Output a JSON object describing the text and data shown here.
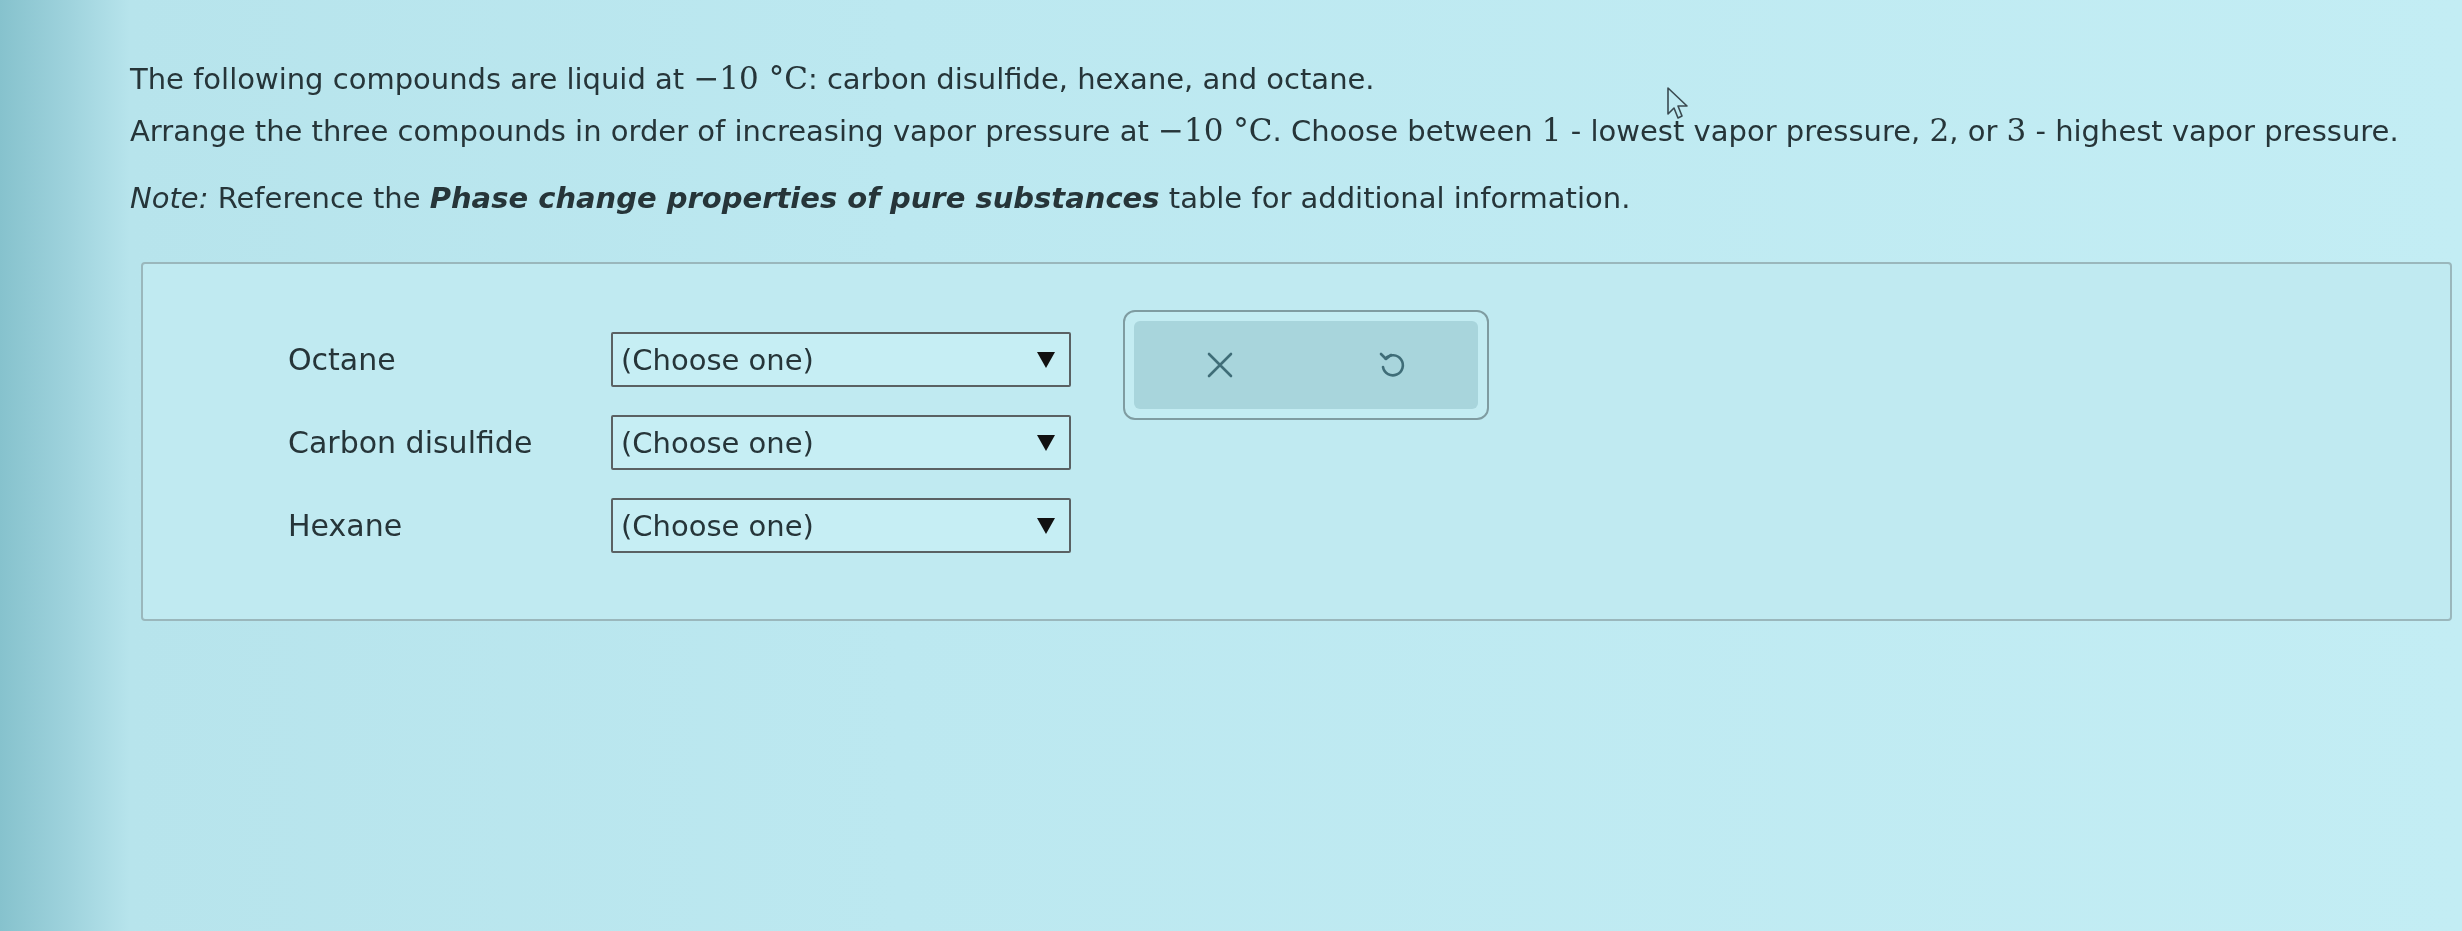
{
  "question": {
    "lines": [
      {
        "segments": [
          {
            "kind": "text",
            "text": "The following compounds are liquid at "
          },
          {
            "kind": "math",
            "text": "−10 °C"
          },
          {
            "kind": "text",
            "text": ": carbon disulfide, hexane, and octane."
          }
        ]
      },
      {
        "segments": [
          {
            "kind": "text",
            "text": "Arrange the three compounds in order of increasing vapor pressure at "
          },
          {
            "kind": "math",
            "text": "−10 °C"
          },
          {
            "kind": "text",
            "text": ". Choose between "
          },
          {
            "kind": "math",
            "text": "1"
          },
          {
            "kind": "text",
            "text": " - lowest vapor pressure, "
          },
          {
            "kind": "math",
            "text": "2"
          },
          {
            "kind": "text",
            "text": ", or "
          },
          {
            "kind": "math",
            "text": "3"
          },
          {
            "kind": "text",
            "text": " - highest vapor pressure."
          }
        ]
      }
    ],
    "note": {
      "segments": [
        {
          "kind": "italic",
          "text": "Note:"
        },
        {
          "kind": "text",
          "text": " Reference the "
        },
        {
          "kind": "bold-italic",
          "text": "Phase change properties of pure substances"
        },
        {
          "kind": "text",
          "text": " table for additional information."
        }
      ]
    }
  },
  "answer_panel": {
    "rows": [
      {
        "label": "Octane",
        "dropdown": "(Choose one)"
      },
      {
        "label": "Carbon disulfide",
        "dropdown": "(Choose one)"
      },
      {
        "label": "Hexane",
        "dropdown": "(Choose one)"
      }
    ],
    "buttons": [
      {
        "kind": "clear"
      },
      {
        "kind": "undo"
      }
    ]
  }
}
